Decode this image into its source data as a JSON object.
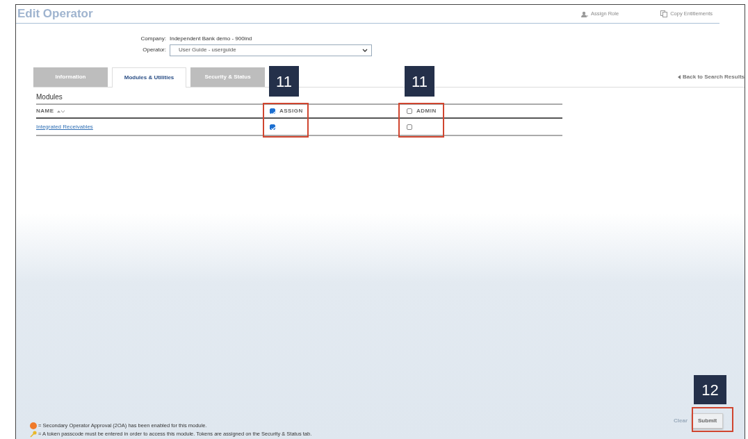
{
  "header": {
    "title": "Edit Operator",
    "actions": [
      {
        "label": "Assign Role",
        "kind": "role"
      },
      {
        "label": "Copy Entitlements",
        "kind": "copy"
      }
    ]
  },
  "company": {
    "label": "Company:",
    "value": "Independent Bank demo - 900ind"
  },
  "operator": {
    "label": "Operator:",
    "value": "User Guide - userguide"
  },
  "tabs": [
    {
      "label": "Information",
      "selected": false
    },
    {
      "label": "Modules & Utilities",
      "selected": true
    },
    {
      "label": "Security & Status",
      "selected": false
    }
  ],
  "back_link": {
    "label": "Back to Search Results"
  },
  "modules": {
    "title": "Modules",
    "name_column": "NAME",
    "assign": {
      "label": "ASSIGN",
      "checked": true
    },
    "admin": {
      "label": "ADMIN",
      "checked": false
    },
    "rows": [
      {
        "name": "Integrated Receivables",
        "assign_checked": true,
        "admin_checked": false
      }
    ]
  },
  "legend": [
    {
      "kind": "approval",
      "text": "= Secondary Operator Approval (2OA) has been enabled for this module."
    },
    {
      "kind": "token",
      "text": "= A token passcode must be entered in order to access this module. Tokens are assigned on the Security & Status tab."
    }
  ],
  "buttons": [
    {
      "label": "Clear",
      "kind": "link"
    },
    {
      "label": "Submit",
      "kind": "button"
    }
  ],
  "callouts": [
    {
      "label": "11",
      "kind": "assign"
    },
    {
      "label": "11",
      "kind": "admin"
    },
    {
      "label": "12",
      "kind": "submit"
    }
  ]
}
